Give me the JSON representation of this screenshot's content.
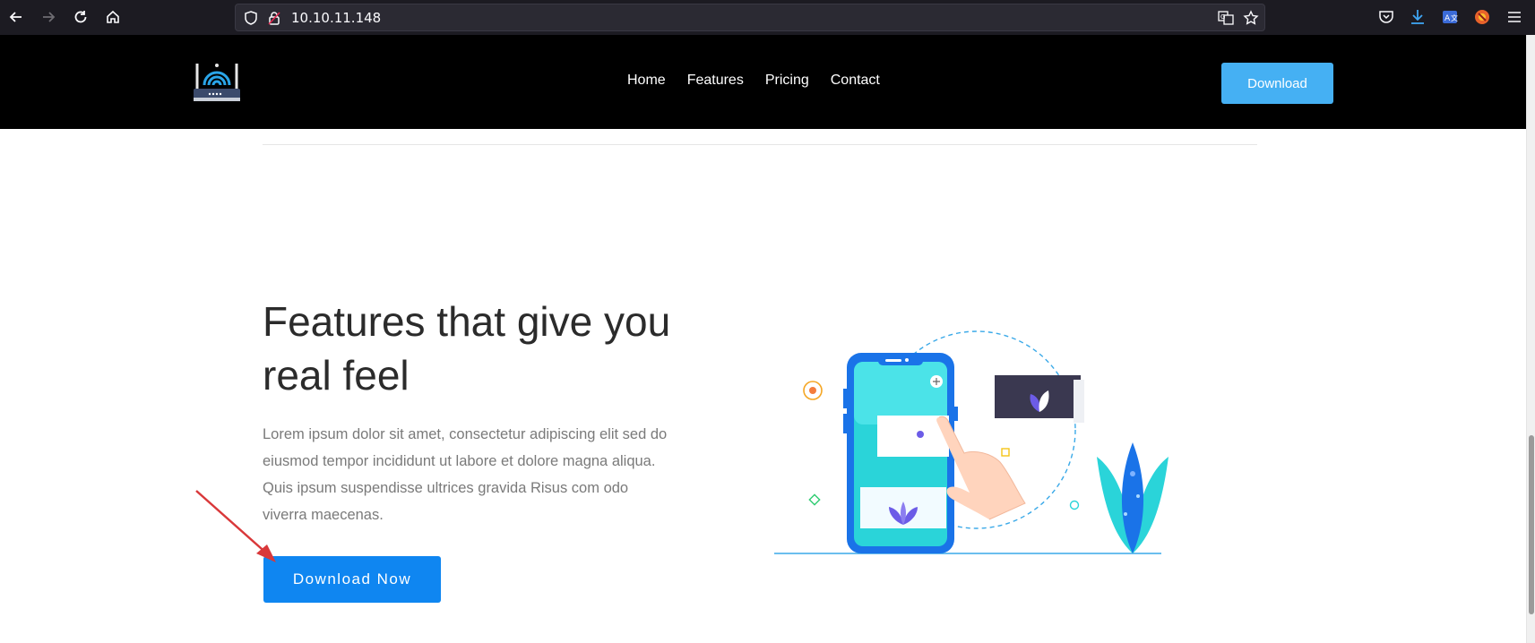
{
  "browser": {
    "url": "10.10.11.148",
    "icons": [
      "back-icon",
      "forward-icon",
      "reload-icon",
      "home-icon",
      "shield-icon",
      "lock-icon",
      "translate-icon",
      "star-icon",
      "pocket-icon",
      "downloads-icon",
      "extension-icon",
      "firefox-account-icon",
      "menu-icon"
    ]
  },
  "header": {
    "nav": [
      "Home",
      "Features",
      "Pricing",
      "Contact"
    ],
    "download_label": "Download",
    "background": "#000000",
    "accent": "#45b0f3"
  },
  "hero": {
    "title": "Features that give you real feel",
    "body": "Lorem ipsum dolor sit amet, consectetur adipiscing elit sed do eiusmod tempor incididunt ut labore et dolore magna aliqua. Quis ipsum suspendisse ultrices gravida Risus com odo viverra maecenas.",
    "cta_label": "Download Now",
    "cta_color": "#0f86f1"
  },
  "annotation": {
    "arrow_color": "#d9383a"
  }
}
